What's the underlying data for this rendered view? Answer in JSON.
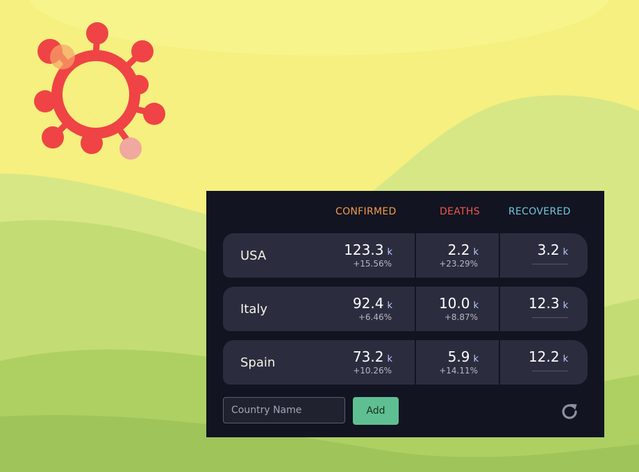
{
  "colors": {
    "panel_bg": "#121421",
    "row_bg": "#2b2d3f",
    "confirmed": "#f39c4a",
    "deaths": "#f0584a",
    "recovered": "#6fc8dc",
    "add_button": "#5fbf93",
    "virus": "#ef4346"
  },
  "icons": {
    "logo": "virus-icon",
    "refresh": "refresh-icon"
  },
  "table": {
    "headers": {
      "confirmed": "CONFIRMED",
      "deaths": "DEATHS",
      "recovered": "RECOVERED"
    },
    "rows": [
      {
        "country": "USA",
        "confirmed": {
          "value": "123.3",
          "unit": "k",
          "change": "+15.56%"
        },
        "deaths": {
          "value": "2.2",
          "unit": "k",
          "change": "+23.29%"
        },
        "recovered": {
          "value": "3.2",
          "unit": "k"
        }
      },
      {
        "country": "Italy",
        "confirmed": {
          "value": "92.4",
          "unit": "k",
          "change": "+6.46%"
        },
        "deaths": {
          "value": "10.0",
          "unit": "k",
          "change": "+8.87%"
        },
        "recovered": {
          "value": "12.3",
          "unit": "k"
        }
      },
      {
        "country": "Spain",
        "confirmed": {
          "value": "73.2",
          "unit": "k",
          "change": "+10.26%"
        },
        "deaths": {
          "value": "5.9",
          "unit": "k",
          "change": "+14.11%"
        },
        "recovered": {
          "value": "12.2",
          "unit": "k"
        }
      }
    ]
  },
  "form": {
    "country_placeholder": "Country Name",
    "country_value": "",
    "add_label": "Add"
  }
}
